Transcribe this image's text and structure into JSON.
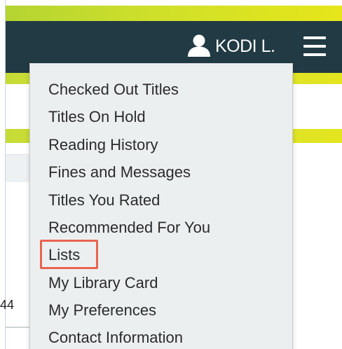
{
  "header": {
    "user_name": "KODI L."
  },
  "background": {
    "cut_off_text": "44"
  },
  "account_menu": {
    "items": [
      {
        "label": "Checked Out Titles"
      },
      {
        "label": "Titles On Hold"
      },
      {
        "label": "Reading History"
      },
      {
        "label": "Fines and Messages"
      },
      {
        "label": "Titles You Rated"
      },
      {
        "label": "Recommended For You"
      },
      {
        "label": "Lists",
        "highlighted": true
      },
      {
        "label": "My Library Card"
      },
      {
        "label": "My Preferences"
      },
      {
        "label": "Contact Information"
      }
    ]
  },
  "colors": {
    "navbar": "#213a44",
    "accent_lime": "#cfe02a",
    "menu_background": "#eceff0",
    "highlight_border": "#e8654f",
    "text": "#2b2b2b"
  },
  "icons": {
    "user": "user-icon",
    "menu": "hamburger-menu-icon"
  }
}
